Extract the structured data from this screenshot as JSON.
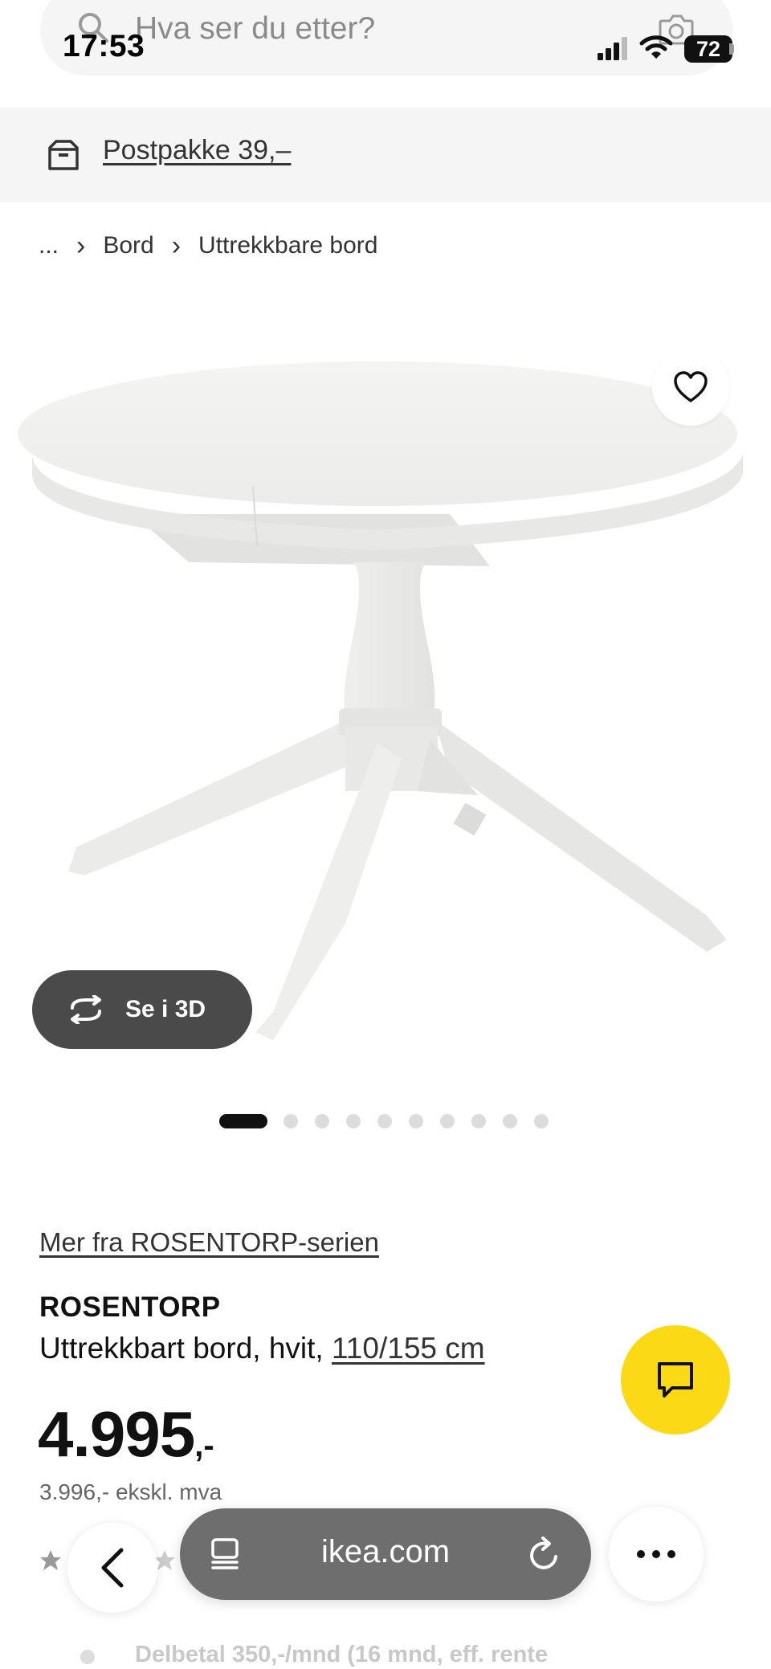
{
  "status_bar": {
    "time": "17:53",
    "battery": "72"
  },
  "search": {
    "placeholder": "Hva ser du etter?"
  },
  "banner": {
    "label": "Postpakke 39,–"
  },
  "breadcrumb": {
    "ellipsis": "...",
    "items": [
      "Bord",
      "Uttrekkbare bord"
    ]
  },
  "gallery": {
    "button_3d": "Se i 3D",
    "total_images": 10,
    "active_index": 0
  },
  "product": {
    "series_link": "Mer fra ROSENTORP-serien",
    "name": "ROSENTORP",
    "description": "Uttrekkbart bord, hvit, ",
    "size_link": "110/155 cm",
    "price": "4.995",
    "price_suffix": ",-",
    "price_ex_vat": "3.996,- ekskl. mva",
    "installment": "Delbetal 350,-/mnd (16 mnd, eff. rente"
  },
  "browser": {
    "url": "ikea.com"
  },
  "colors": {
    "chat_yellow": "#fbd914",
    "url_bar": "#6e6e6e",
    "banner_bg": "#f5f5f5"
  },
  "icons": [
    "search-icon",
    "camera-icon",
    "signal-icon",
    "wifi-icon",
    "box-icon",
    "heart-icon",
    "rotate-3d-icon",
    "chat-icon",
    "chevron-left-icon",
    "tabs-icon",
    "reload-icon",
    "more-icon",
    "star-icon"
  ]
}
